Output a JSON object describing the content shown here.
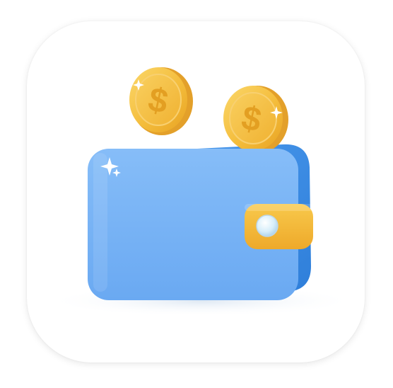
{
  "icon": {
    "name": "wallet-app-icon",
    "colors": {
      "background": "#ffffff",
      "wallet_front": "#78b4f7",
      "wallet_back": "#3f8fe6",
      "clasp": "#f3b93a",
      "button": "#d7eefa",
      "coin": "#f4bd3c",
      "coin_rim": "#f9cf5e",
      "coin_symbol": "#e8a323"
    },
    "coins": [
      {
        "symbol": "$"
      },
      {
        "symbol": "$"
      }
    ]
  }
}
